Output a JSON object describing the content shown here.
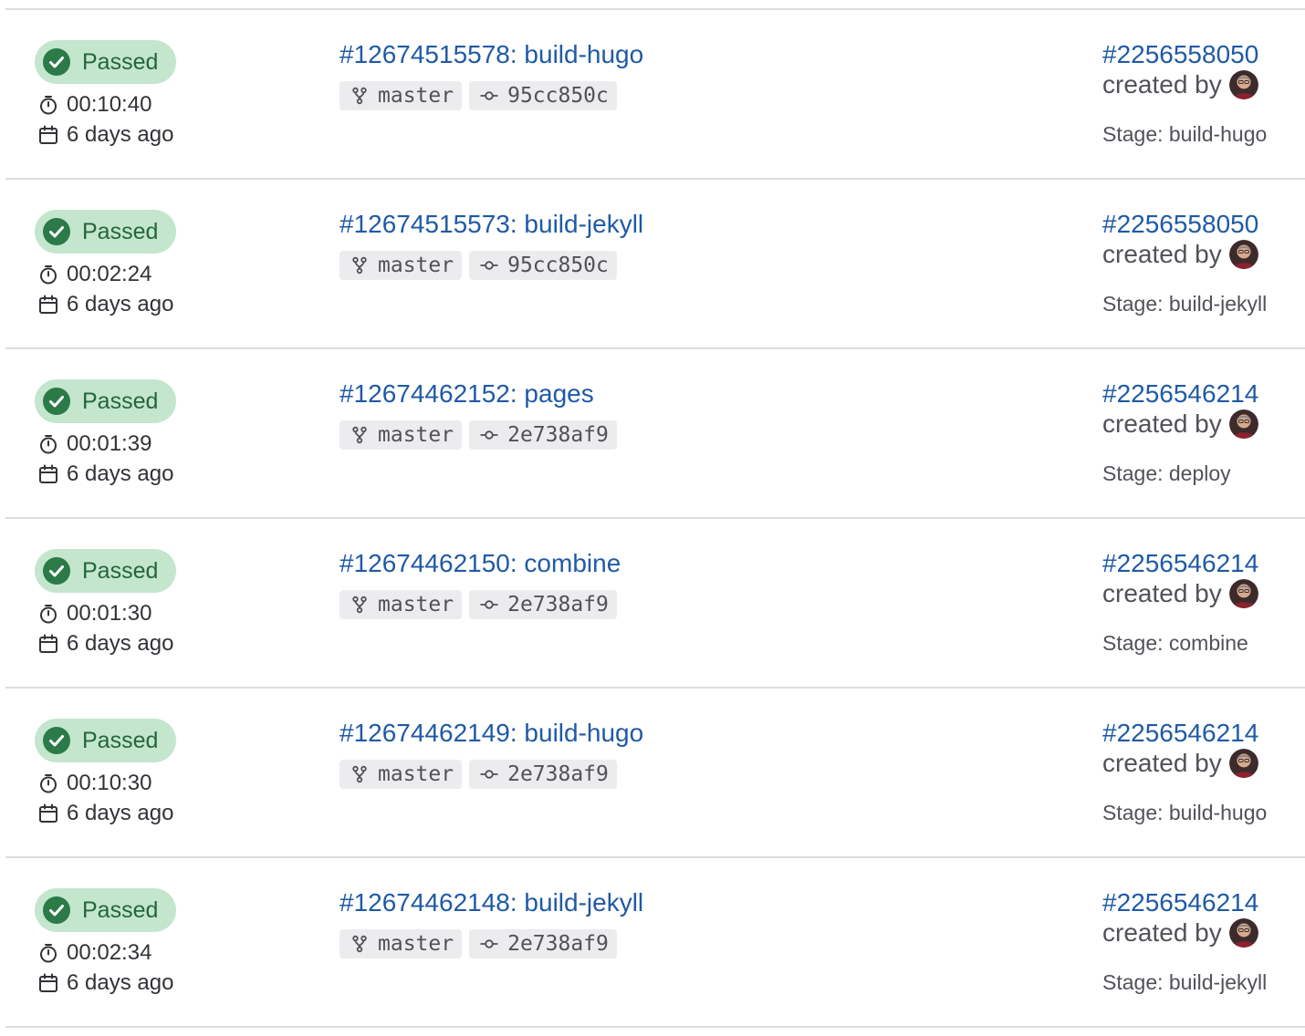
{
  "colors": {
    "badge_bg": "#c3e6cd",
    "badge_text": "#24663b",
    "link": "#1f5aa6",
    "chip_bg": "#ececef",
    "divider": "#dcdcde"
  },
  "jobs": [
    {
      "status": "Passed",
      "duration": "00:10:40",
      "finished": "6 days ago",
      "job": "#12674515578: build-hugo",
      "ref": "master",
      "commit": "95cc850c",
      "pipeline": "#2256558050",
      "created_by": "created by",
      "stage": "Stage: build-hugo"
    },
    {
      "status": "Passed",
      "duration": "00:02:24",
      "finished": "6 days ago",
      "job": "#12674515573: build-jekyll",
      "ref": "master",
      "commit": "95cc850c",
      "pipeline": "#2256558050",
      "created_by": "created by",
      "stage": "Stage: build-jekyll"
    },
    {
      "status": "Passed",
      "duration": "00:01:39",
      "finished": "6 days ago",
      "job": "#12674462152: pages",
      "ref": "master",
      "commit": "2e738af9",
      "pipeline": "#2256546214",
      "created_by": "created by",
      "stage": "Stage: deploy"
    },
    {
      "status": "Passed",
      "duration": "00:01:30",
      "finished": "6 days ago",
      "job": "#12674462150: combine",
      "ref": "master",
      "commit": "2e738af9",
      "pipeline": "#2256546214",
      "created_by": "created by",
      "stage": "Stage: combine"
    },
    {
      "status": "Passed",
      "duration": "00:10:30",
      "finished": "6 days ago",
      "job": "#12674462149: build-hugo",
      "ref": "master",
      "commit": "2e738af9",
      "pipeline": "#2256546214",
      "created_by": "created by",
      "stage": "Stage: build-hugo"
    },
    {
      "status": "Passed",
      "duration": "00:02:34",
      "finished": "6 days ago",
      "job": "#12674462148: build-jekyll",
      "ref": "master",
      "commit": "2e738af9",
      "pipeline": "#2256546214",
      "created_by": "created by",
      "stage": "Stage: build-jekyll"
    }
  ]
}
